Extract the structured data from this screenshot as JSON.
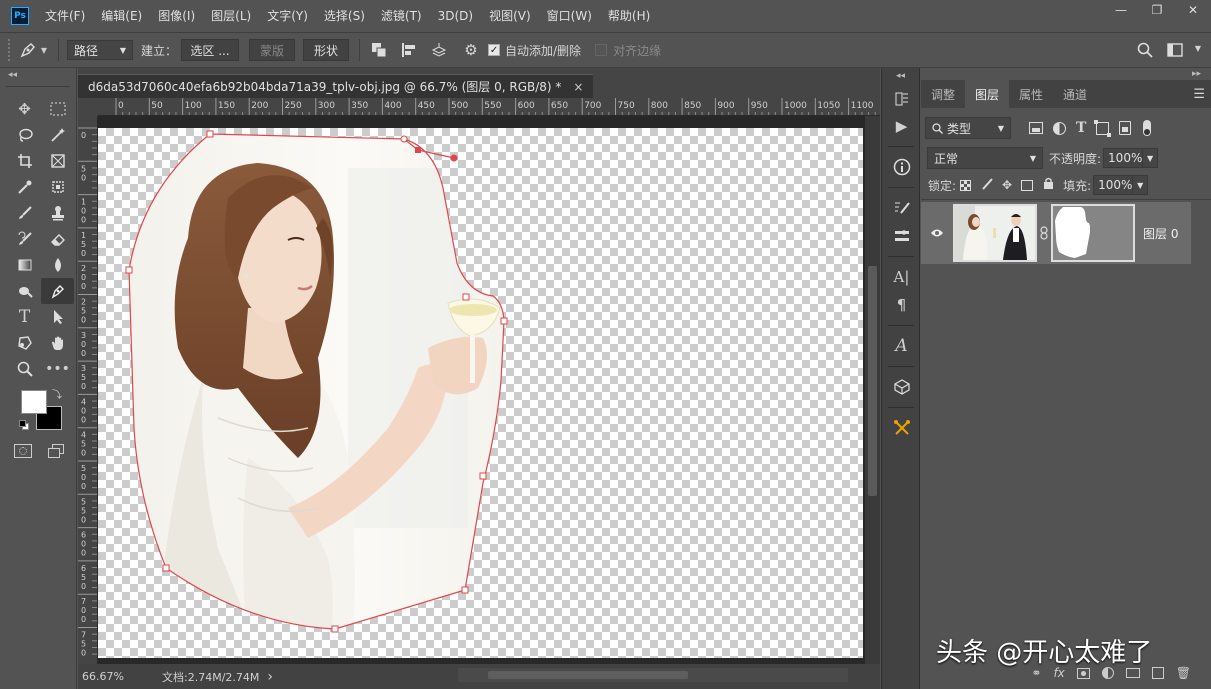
{
  "app": {
    "logo": "Ps"
  },
  "menubar": {
    "items": [
      "文件(F)",
      "编辑(E)",
      "图像(I)",
      "图层(L)",
      "文字(Y)",
      "选择(S)",
      "滤镜(T)",
      "3D(D)",
      "视图(V)",
      "窗口(W)",
      "帮助(H)"
    ]
  },
  "window_controls": {
    "minimize": "—",
    "restore": "❐",
    "close": "✕"
  },
  "options_bar": {
    "mode_select": "路径",
    "make_label": "建立：",
    "selection_button": "选区 ...",
    "mask_button": "蒙版",
    "shape_button": "形状",
    "auto_add_delete_label": "自动添加/删除",
    "auto_add_delete_checked": true,
    "align_edges_label": "对齐边缘",
    "align_edges_checked": false
  },
  "document": {
    "tab_title": "d6da53d7060c40efa6b92b04bda71a39_tplv-obj.jpg @ 66.7% (图层 0, RGB/8) *",
    "tab_close": "×",
    "ruler_top_ticks": [
      "0",
      "50",
      "100",
      "150",
      "200",
      "250",
      "300",
      "350",
      "400",
      "450",
      "500",
      "550",
      "600",
      "650",
      "700",
      "750",
      "800",
      "850",
      "900",
      "950",
      "1000",
      "1050",
      "1100"
    ],
    "ruler_left_ticks": [
      "0",
      "50",
      "100",
      "150",
      "200",
      "250",
      "300",
      "350",
      "400",
      "450",
      "500",
      "550",
      "600",
      "650",
      "700",
      "750"
    ]
  },
  "status_bar": {
    "zoom": "66.67%",
    "doc_info": "文档:2.74M/2.74M",
    "arrow": "›"
  },
  "layers_panel": {
    "tabs": [
      "调整",
      "图层",
      "属性",
      "通道"
    ],
    "active_tab": "图层",
    "filter_type": "类型",
    "blend_mode": "正常",
    "opacity_label": "不透明度:",
    "opacity_value": "100%",
    "lock_label": "锁定:",
    "fill_label": "填充:",
    "fill_value": "100%",
    "layers": [
      {
        "name": "图层 0",
        "visible": true,
        "has_mask": true
      }
    ]
  },
  "watermark": "头条 @开心太难了",
  "colors": {
    "ui_bg": "#535353",
    "canvas_bg": "#282828",
    "path_stroke": "#e0474c",
    "accent_ps": "#31a8ff"
  }
}
